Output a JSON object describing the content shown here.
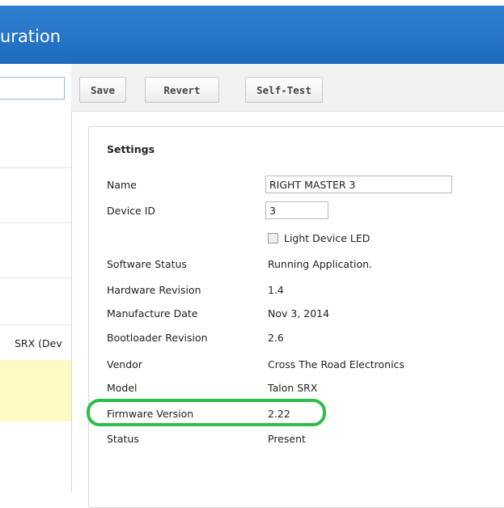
{
  "window": {
    "title": "uration"
  },
  "left_panel": {
    "device_text": "SRX (Dev"
  },
  "toolbar": {
    "save": "Save",
    "revert": "Revert",
    "selftest": "Self-Test"
  },
  "settings": {
    "heading": "Settings",
    "name_label": "Name",
    "name_value": "RIGHT MASTER 3",
    "device_id_label": "Device ID",
    "device_id_value": "3",
    "led_label": "Light Device LED",
    "rows": [
      {
        "label": "Software Status",
        "value": "Running Application."
      },
      {
        "label": "Hardware Revision",
        "value": "1.4"
      },
      {
        "label": "Manufacture Date",
        "value": "Nov 3, 2014"
      },
      {
        "label": "Bootloader Revision",
        "value": "2.6"
      },
      {
        "label": "Vendor",
        "value": "Cross The Road Electronics"
      },
      {
        "label": "Model",
        "value": "Talon SRX"
      },
      {
        "label": "Firmware Version",
        "value": "2.22"
      },
      {
        "label": "Status",
        "value": "Present"
      }
    ]
  },
  "colors": {
    "title_bar": "#1f6bbd",
    "highlight": "#2ebd4a",
    "selected_row": "#fff9c4"
  }
}
